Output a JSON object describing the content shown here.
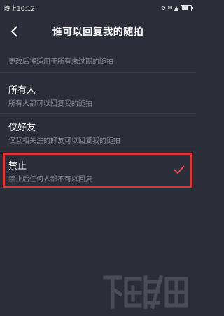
{
  "status_bar": {
    "time": "晚上10:12",
    "indicators": "⚙ ✉ ▲"
  },
  "header": {
    "title": "谁可以回复我的随拍",
    "back_icon": "chevron-left-icon"
  },
  "hint": "更改后将适用于所有未过期的随拍",
  "options": [
    {
      "label": "所有人",
      "desc": "所有人都可以回复我的随拍",
      "selected": false
    },
    {
      "label": "仅好友",
      "desc": "仅互相关注的好友可以回复我的随拍",
      "selected": false
    },
    {
      "label": "禁止",
      "desc": "禁止后任何人都不可以回复",
      "selected": true
    }
  ],
  "colors": {
    "background": "#2b2e38",
    "highlight": "#d8393a",
    "check": "#f0505a",
    "muted_text": "#8b8e98"
  }
}
